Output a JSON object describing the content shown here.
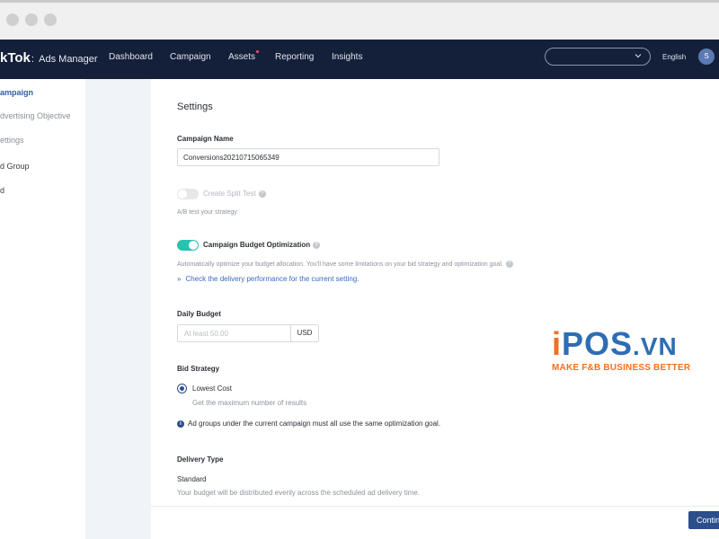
{
  "app": {
    "logo_main": "kTok",
    "logo_colon": ":",
    "logo_sub": "Ads Manager"
  },
  "nav": {
    "items": [
      "Dashboard",
      "Campaign",
      "Assets",
      "Reporting",
      "Insights"
    ],
    "select_value": "",
    "language": "English",
    "avatar_initial": "S",
    "notification_color": "#ff4d6a"
  },
  "sidebar": {
    "items": [
      "ampaign",
      "dvertising Objective",
      "ettings",
      "d Group",
      "d"
    ]
  },
  "settings": {
    "title": "Settings",
    "campaign_name_label": "Campaign Name",
    "campaign_name_value": "Conversions20210715065349",
    "split_test_label": "Create Split Test",
    "split_test_hint": "A/B test your strategy",
    "split_test_enabled": false,
    "cbo_label": "Campaign Budget Optimization",
    "cbo_hint": "Automatically optimize your budget allocation. You'll have some limitations on your bid strategy and optimization goal.",
    "cbo_enabled": true,
    "cbo_link": "Check the delivery performance for the current setting.",
    "daily_budget_label": "Daily Budget",
    "daily_budget_placeholder": "At least 50.00",
    "currency": "USD",
    "bid_strategy_label": "Bid Strategy",
    "bid_option_label": "Lowest Cost",
    "bid_option_hint": "Get the maximum number of results",
    "bid_note": "Ad groups under the current campaign must all use the same optimization goal.",
    "delivery_type_label": "Delivery Type",
    "delivery_option": "Standard",
    "delivery_hint": "Your budget will be distributed evenly across the scheduled ad delivery time."
  },
  "footer": {
    "continue_label": "Continue"
  },
  "watermark": {
    "brand_i": "i",
    "brand_main": "POS",
    "brand_vn": ".VN",
    "tagline": "MAKE F&B BUSINESS BETTER",
    "brand_blue": "#2e6db4",
    "brand_orange": "#f36f21"
  },
  "colors": {
    "nav_bg": "#14203a",
    "accent": "#2b4e8c",
    "toggle_on": "#27c2b0",
    "link": "#3a6bc0"
  }
}
